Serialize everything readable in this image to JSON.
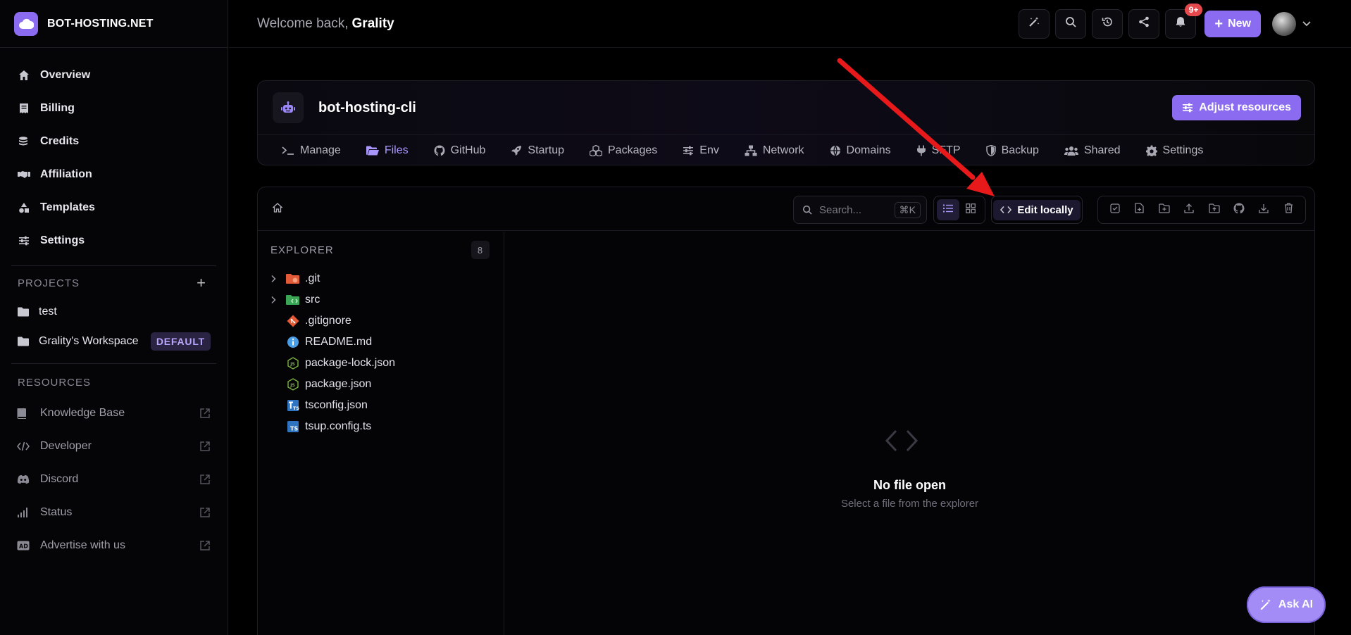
{
  "brand": {
    "name": "BOT-HOSTING.NET"
  },
  "topbar": {
    "welcome_prefix": "Welcome back,",
    "username": "Grality",
    "notif_count": "9+",
    "new_label": "New"
  },
  "sidebar": {
    "nav": [
      {
        "label": "Overview",
        "icon": "home-icon"
      },
      {
        "label": "Billing",
        "icon": "receipt-icon"
      },
      {
        "label": "Credits",
        "icon": "coins-icon"
      },
      {
        "label": "Affiliation",
        "icon": "handshake-icon"
      },
      {
        "label": "Templates",
        "icon": "shapes-icon"
      },
      {
        "label": "Settings",
        "icon": "sliders-icon"
      }
    ],
    "projects_heading": "PROJECTS",
    "projects": [
      {
        "label": "test",
        "badge": ""
      },
      {
        "label": "Grality's Workspace",
        "badge": "DEFAULT"
      }
    ],
    "resources_heading": "RESOURCES",
    "resources": [
      {
        "label": "Knowledge Base",
        "icon": "book-icon"
      },
      {
        "label": "Developer",
        "icon": "code-icon"
      },
      {
        "label": "Discord",
        "icon": "discord-icon"
      },
      {
        "label": "Status",
        "icon": "signal-icon"
      },
      {
        "label": "Advertise with us",
        "icon": "ad-icon"
      }
    ]
  },
  "server": {
    "name": "bot-hosting-cli",
    "adjust_label": "Adjust resources",
    "tabs": [
      {
        "label": "Manage",
        "icon": "terminal-icon",
        "active": false
      },
      {
        "label": "Files",
        "icon": "folder-open-icon",
        "active": true
      },
      {
        "label": "GitHub",
        "icon": "github-icon",
        "active": false
      },
      {
        "label": "Startup",
        "icon": "rocket-icon",
        "active": false
      },
      {
        "label": "Packages",
        "icon": "cubes-icon",
        "active": false
      },
      {
        "label": "Env",
        "icon": "sliders-icon",
        "active": false
      },
      {
        "label": "Network",
        "icon": "network-icon",
        "active": false
      },
      {
        "label": "Domains",
        "icon": "globe-icon",
        "active": false
      },
      {
        "label": "SFTP",
        "icon": "plug-icon",
        "active": false
      },
      {
        "label": "Backup",
        "icon": "shield-icon",
        "active": false
      },
      {
        "label": "Shared",
        "icon": "users-icon",
        "active": false
      },
      {
        "label": "Settings",
        "icon": "gear-icon",
        "active": false
      }
    ]
  },
  "files": {
    "search_placeholder": "Search...",
    "search_shortcut": "⌘K",
    "edit_locally_label": "Edit locally",
    "explorer_heading": "EXPLORER",
    "explorer_count": "8",
    "tree": [
      {
        "name": ".git",
        "type": "folder",
        "icon": "git-folder-icon"
      },
      {
        "name": "src",
        "type": "folder",
        "icon": "src-folder-icon"
      },
      {
        "name": ".gitignore",
        "type": "file",
        "icon": "git-icon"
      },
      {
        "name": "README.md",
        "type": "file",
        "icon": "info-icon"
      },
      {
        "name": "package-lock.json",
        "type": "file",
        "icon": "nodejs-icon"
      },
      {
        "name": "package.json",
        "type": "file",
        "icon": "nodejs-icon"
      },
      {
        "name": "tsconfig.json",
        "type": "file",
        "icon": "tsconfig-icon"
      },
      {
        "name": "tsup.config.ts",
        "type": "file",
        "icon": "typescript-icon"
      }
    ],
    "empty_title": "No file open",
    "empty_subtitle": "Select a file from the explorer"
  },
  "ask_ai_label": "Ask AI",
  "colors": {
    "accent": "#8b6cf0",
    "background": "#000000",
    "badge_red": "#e5484d",
    "annotation_red": "#e8191b"
  }
}
